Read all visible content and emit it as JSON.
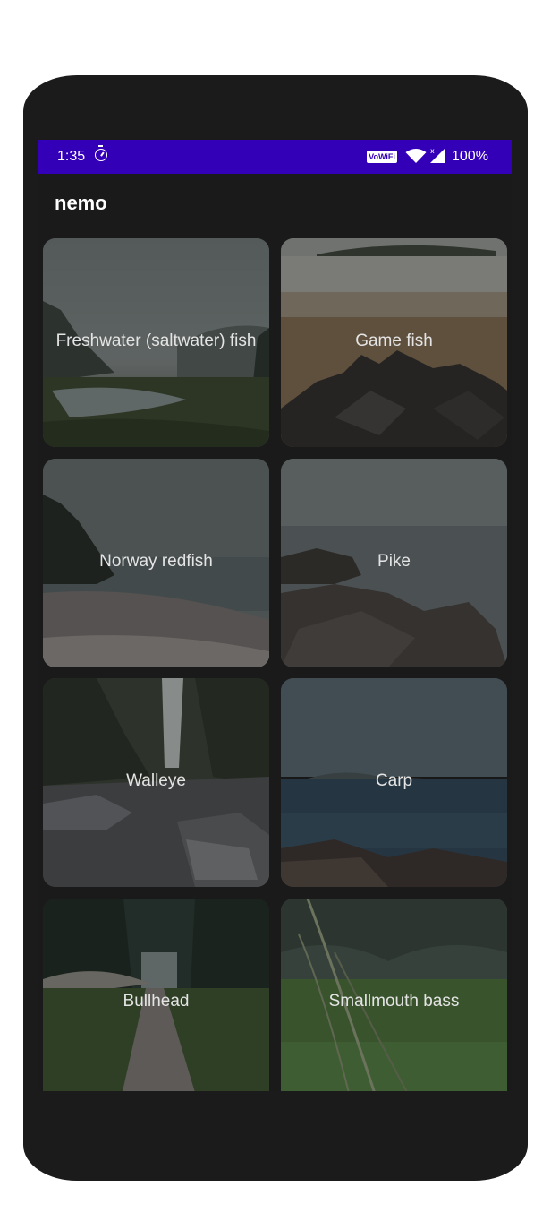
{
  "status_bar": {
    "time": "1:35",
    "timer_icon": "stopwatch-icon",
    "vowifi": "VoWiFi",
    "wifi_icon": "wifi-icon",
    "signal_icon": "signal-icon",
    "battery": "100%"
  },
  "app_bar": {
    "title": "nemo"
  },
  "categories": [
    {
      "label": "Freshwater (saltwater) fish"
    },
    {
      "label": "Game fish"
    },
    {
      "label": "Norway redfish"
    },
    {
      "label": "Pike"
    },
    {
      "label": "Walleye"
    },
    {
      "label": "Carp"
    },
    {
      "label": "Bullhead"
    },
    {
      "label": "Smallmouth bass"
    }
  ],
  "colors": {
    "status_bar": "#3300b8",
    "background": "#1a1a1a",
    "text": "#ffffff"
  }
}
